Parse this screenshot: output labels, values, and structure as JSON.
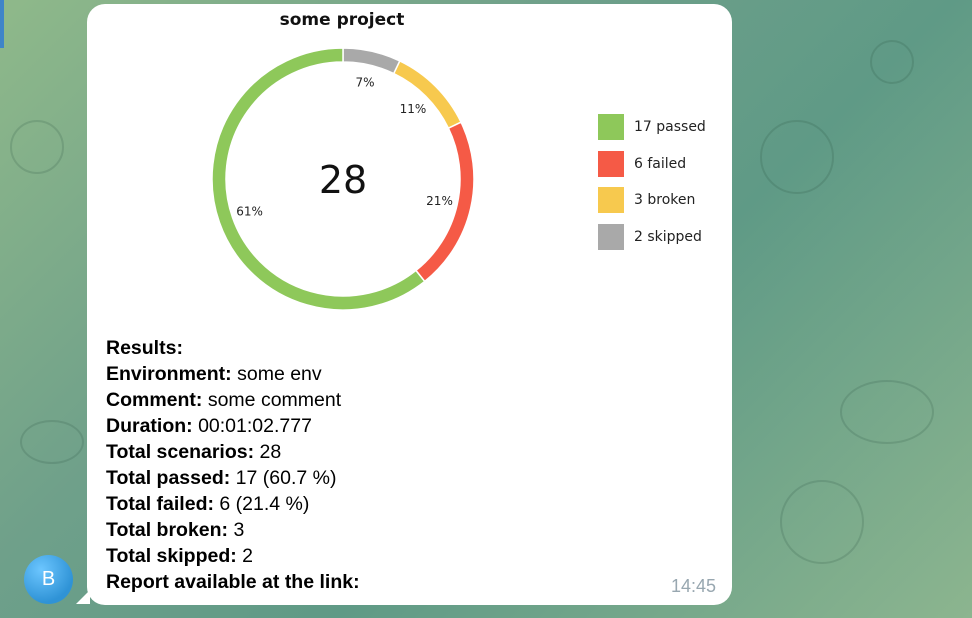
{
  "chart_data": {
    "type": "pie",
    "title": "some project",
    "center_label": "28",
    "slices": [
      {
        "label": "passed",
        "value": 17,
        "percent_label": "61%",
        "color": "#8ec85a"
      },
      {
        "label": "failed",
        "value": 6,
        "percent_label": "21%",
        "color": "#f55a46"
      },
      {
        "label": "broken",
        "value": 3,
        "percent_label": "11%",
        "color": "#f7c94e"
      },
      {
        "label": "skipped",
        "value": 2,
        "percent_label": "7%",
        "color": "#a9a9a9"
      }
    ],
    "legend": [
      {
        "text": "17 passed",
        "color": "#8ec85a"
      },
      {
        "text": "6 failed",
        "color": "#f55a46"
      },
      {
        "text": "3 broken",
        "color": "#f7c94e"
      },
      {
        "text": "2 skipped",
        "color": "#a9a9a9"
      }
    ],
    "legend_placement": "right"
  },
  "avatar_letter": "B",
  "results": [
    {
      "key": "Results:",
      "value": ""
    },
    {
      "key": "Environment:",
      "value": " some env"
    },
    {
      "key": "Comment:",
      "value": " some comment"
    },
    {
      "key": "Duration:",
      "value": " 00:01:02.777"
    },
    {
      "key": "Total scenarios:",
      "value": " 28"
    },
    {
      "key": "Total passed:",
      "value": " 17 (60.7 %)"
    },
    {
      "key": "Total failed:",
      "value": " 6 (21.4 %)"
    },
    {
      "key": "Total broken:",
      "value": " 3"
    },
    {
      "key": "Total skipped:",
      "value": " 2"
    },
    {
      "key": "Report available at the link:",
      "value": ""
    }
  ],
  "timestamp": "14:45"
}
